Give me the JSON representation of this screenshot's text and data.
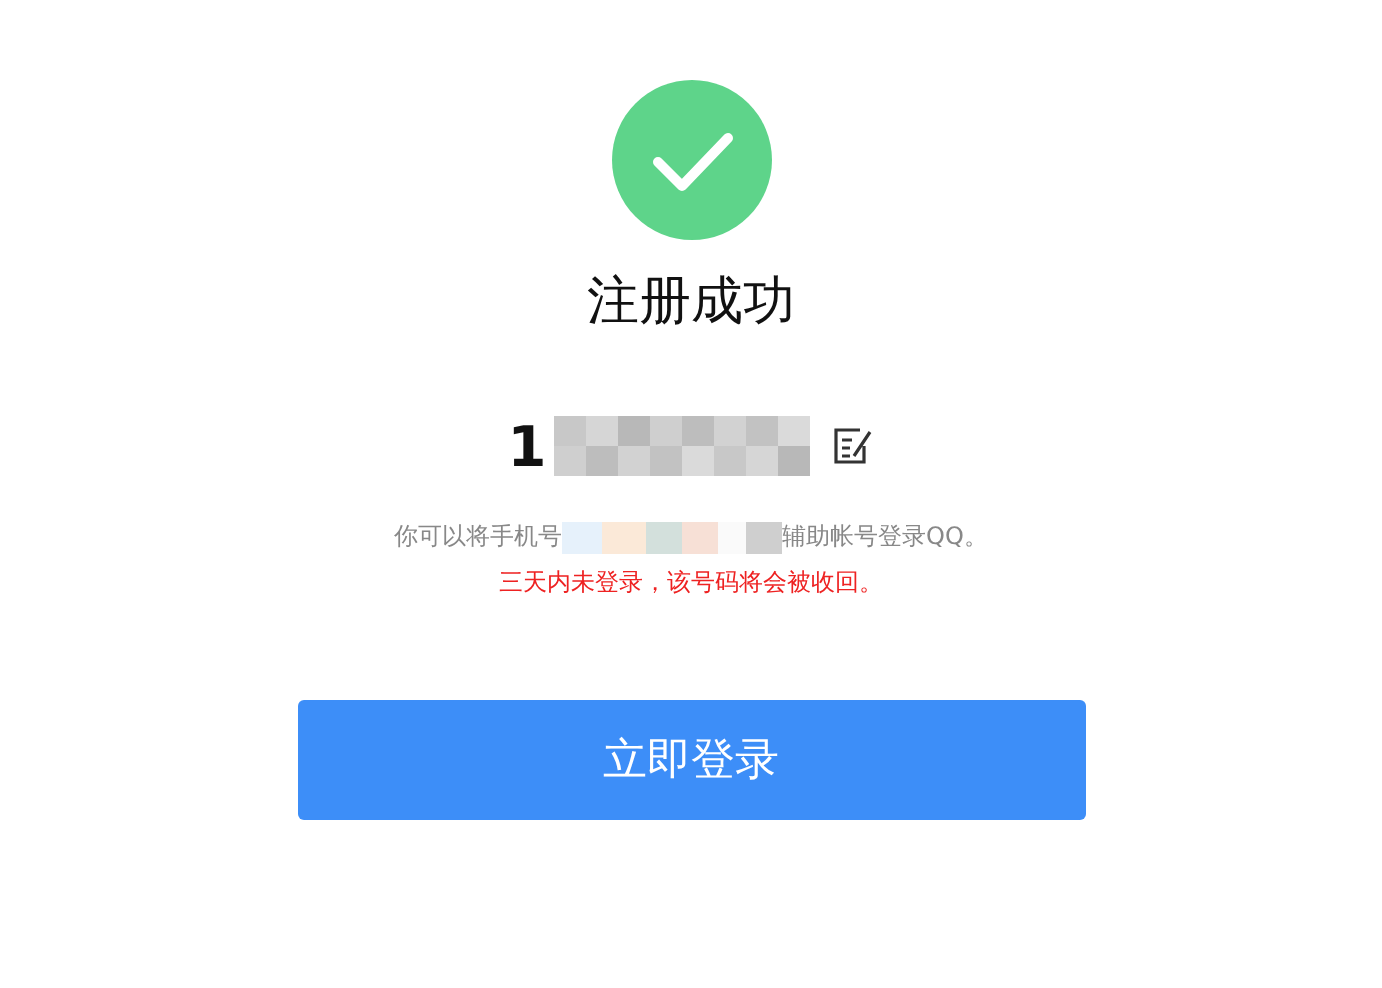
{
  "title": "注册成功",
  "account": {
    "prefix": "1"
  },
  "hint": {
    "before": "你可以将手机号",
    "after": "辅助帐号登录QQ。"
  },
  "warning": "三天内未登录，该号码将会被收回。",
  "button": "立即登录"
}
